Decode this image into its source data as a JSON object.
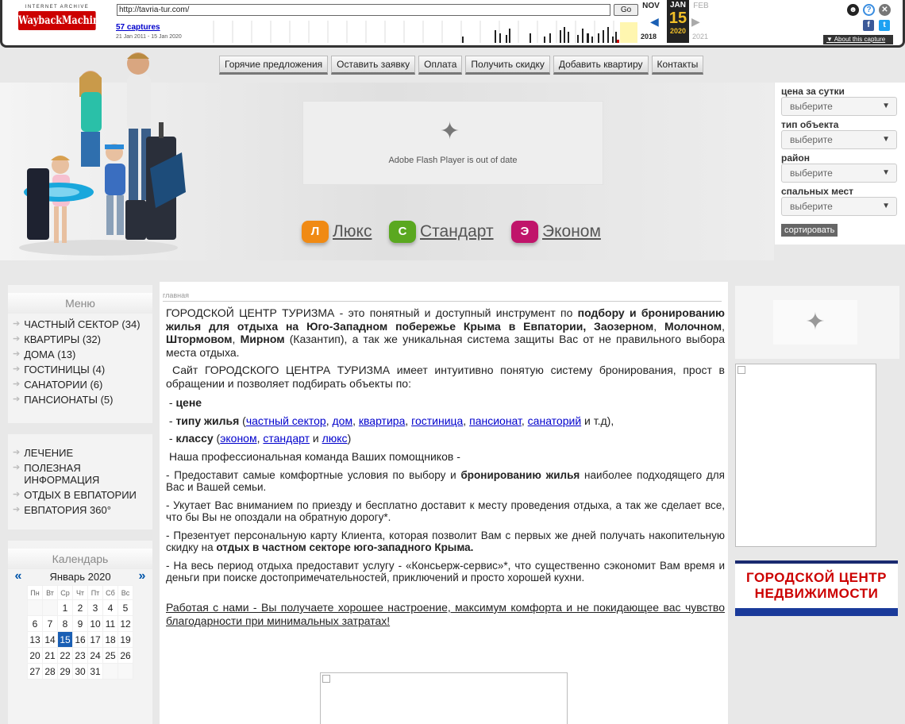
{
  "wayback": {
    "logo_top": "INTERNET ARCHIVE",
    "logo_main": "WaybackMachine",
    "url": "http://tavria-tur.com/",
    "go_label": "Go",
    "captures": "57 captures",
    "range": "21 Jan 2011 - 15 Jan 2020",
    "months": [
      "NOV",
      "JAN",
      "FEB"
    ],
    "day": "15",
    "years": [
      "2018",
      "2020",
      "2021"
    ],
    "about": "About this capture"
  },
  "nav": [
    "Горячие предложения",
    "Оставить заявку",
    "Оплата",
    "Получить скидку",
    "Добавить квартиру",
    "Контакты"
  ],
  "flash_text": "Adobe Flash Player is out of date",
  "classes": [
    {
      "badge": "Л",
      "label": "Люкс",
      "color": "#f08a14"
    },
    {
      "badge": "С",
      "label": "Стандарт",
      "color": "#5aa820"
    },
    {
      "badge": "Э",
      "label": "Эконом",
      "color": "#c0146a"
    }
  ],
  "filter": {
    "labels": [
      "цена за сутки",
      "тип объекта",
      "район",
      "спальных мест"
    ],
    "placeholder": "выберите",
    "sort_label": "сортировать"
  },
  "menu": {
    "title": "Меню",
    "items": [
      "ЧАСТНЫЙ СЕКТОР (34)",
      "КВАРТИРЫ (32)",
      "ДОМА (13)",
      "ГОСТИНИЦЫ (4)",
      "САНАТОРИИ (6)",
      "ПАНСИОНАТЫ (5)"
    ],
    "items2": [
      "ЛЕЧЕНИЕ",
      "ПОЛЕЗНАЯ ИНФОРМАЦИЯ",
      "ОТДЫХ В ЕВПАТОРИИ",
      "ЕВПАТОРИЯ 360°"
    ]
  },
  "calendar": {
    "title": "Календарь",
    "month": "Январь 2020",
    "prev": "«",
    "next": "»",
    "weekdays": [
      "Пн",
      "Вт",
      "Ср",
      "Чт",
      "Пт",
      "Сб",
      "Вс"
    ],
    "weeks": [
      [
        "",
        "",
        "1",
        "2",
        "3",
        "4",
        "5"
      ],
      [
        "6",
        "7",
        "8",
        "9",
        "10",
        "11",
        "12"
      ],
      [
        "13",
        "14",
        "15",
        "16",
        "17",
        "18",
        "19"
      ],
      [
        "20",
        "21",
        "22",
        "23",
        "24",
        "25",
        "26"
      ],
      [
        "27",
        "28",
        "29",
        "30",
        "31",
        "",
        ""
      ]
    ],
    "today": "15"
  },
  "content": {
    "breadcrumb": "главная",
    "p1_a": "ГОРОДСКОЙ ЦЕНТР ТУРИЗМА - это понятный и доступный инструмент по ",
    "p1_b": "подбору и бронированию жилья для отдыха на Юго-Западном побережье Крыма в Евпатории, Заозерном",
    "p1_c": ", ",
    "p1_d": "Молочном",
    "p1_e": ", ",
    "p1_f": "Штормовом",
    "p1_g": ", ",
    "p1_h": "Мирном",
    "p1_i": " (Казантип), а так же уникальная система защиты Вас от не правильного выбора места отдыха.",
    "p2": "Сайт ГОРОДСКОГО ЦЕНТРА ТУРИЗМА имеет интуитивно понятую систему бронирования, прост в обращении и позволяет подбирать объекты по:",
    "b1": "цене",
    "b2_label": "типу жилья",
    "b2_links": [
      "частный сектор",
      "дом",
      "квартира",
      "гостиница",
      "пансионат",
      "санаторий"
    ],
    "b2_tail": "и т.д),",
    "b3_label": "классу",
    "b3_links": [
      "эконом",
      "стандарт",
      "люкс"
    ],
    "b3_and": "и",
    "team": "Наша профессиональная команда Ваших помощников -",
    "s1_a": "- Предоставит самые комфортные условия по выбору и ",
    "s1_b": "бронированию жилья",
    "s1_c": " наиболее подходящего для Вас и Вашей семьи.",
    "s2": "- Укутает Вас вниманием по приезду и бесплатно доставит к месту проведения отдыха, а так же сделает все, что бы Вы не опоздали на обратную дорогу*.",
    "s3_a": "- Презентует персональную карту Клиента, которая позволит Вам с первых же дней получать накопительную скидку на ",
    "s3_b": "отдых в частном секторе юго-западного Крыма.",
    "s4": "- На весь период отдыха предоставит услугу - «Консьерж-сервис»*, что существенно сэкономит Вам время и деньги при поиске достопримечательностей, приключений и просто хорошей кухни.",
    "final": "Работая с нами - Вы получаете хорошее настроение, максимум комфорта и не покидающее вас чувство благодарности при минимальных затратах!"
  },
  "ad": {
    "line1": "ГОРОДСКОЙ ЦЕНТР",
    "line2": "НЕДВИЖИМОСТИ"
  }
}
